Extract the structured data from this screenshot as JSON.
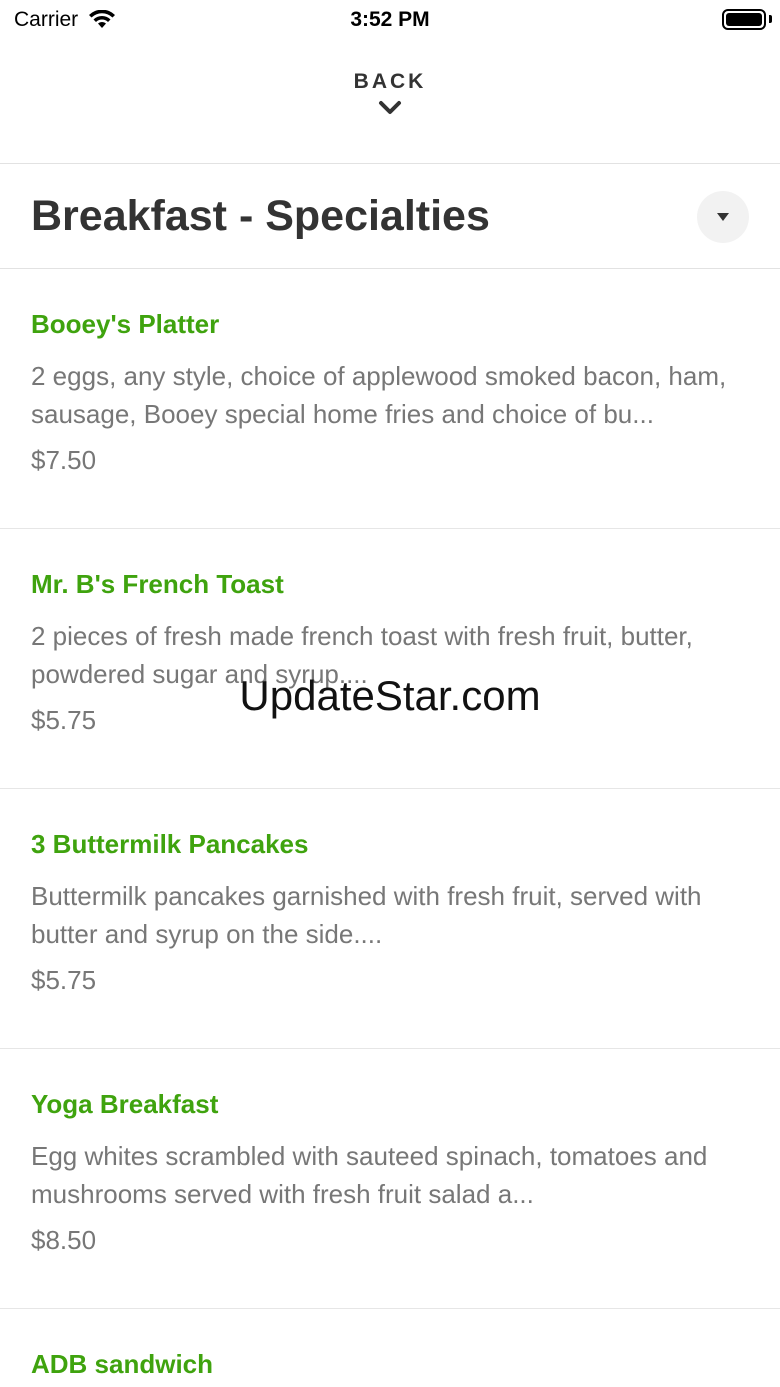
{
  "status": {
    "carrier": "Carrier",
    "time": "3:52 PM"
  },
  "nav": {
    "back_label": "BACK"
  },
  "category": {
    "title": "Breakfast - Specialties"
  },
  "items": [
    {
      "name": "Booey's Platter",
      "description": "2 eggs, any style, choice of applewood smoked bacon, ham, sausage, Booey special home fries and choice of bu...",
      "price": "$7.50"
    },
    {
      "name": "Mr. B's French Toast",
      "description": "2 pieces of fresh made french toast with fresh fruit, butter, powdered sugar and syrup....",
      "price": "$5.75"
    },
    {
      "name": "3 Buttermilk Pancakes",
      "description": "Buttermilk pancakes garnished with fresh fruit, served with butter and syrup on the side....",
      "price": "$5.75"
    },
    {
      "name": "Yoga Breakfast",
      "description": "Egg whites scrambled with sauteed spinach, tomatoes and mushrooms served with fresh fruit salad a...",
      "price": "$8.50"
    },
    {
      "name": "ADB sandwich",
      "description": "",
      "price": ""
    }
  ],
  "watermark": "UpdateStar.com",
  "colors": {
    "accent": "#3fa30e",
    "text": "#333333",
    "muted": "#777777"
  }
}
